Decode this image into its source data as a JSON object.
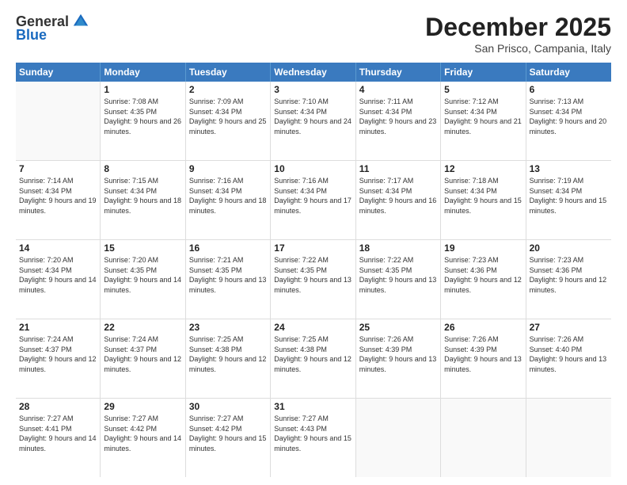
{
  "header": {
    "logo_general": "General",
    "logo_blue": "Blue",
    "month_title": "December 2025",
    "location": "San Prisco, Campania, Italy"
  },
  "days_of_week": [
    "Sunday",
    "Monday",
    "Tuesday",
    "Wednesday",
    "Thursday",
    "Friday",
    "Saturday"
  ],
  "weeks": [
    [
      {
        "day": "",
        "sunrise": "",
        "sunset": "",
        "daylight": ""
      },
      {
        "day": "1",
        "sunrise": "Sunrise: 7:08 AM",
        "sunset": "Sunset: 4:35 PM",
        "daylight": "Daylight: 9 hours and 26 minutes."
      },
      {
        "day": "2",
        "sunrise": "Sunrise: 7:09 AM",
        "sunset": "Sunset: 4:34 PM",
        "daylight": "Daylight: 9 hours and 25 minutes."
      },
      {
        "day": "3",
        "sunrise": "Sunrise: 7:10 AM",
        "sunset": "Sunset: 4:34 PM",
        "daylight": "Daylight: 9 hours and 24 minutes."
      },
      {
        "day": "4",
        "sunrise": "Sunrise: 7:11 AM",
        "sunset": "Sunset: 4:34 PM",
        "daylight": "Daylight: 9 hours and 23 minutes."
      },
      {
        "day": "5",
        "sunrise": "Sunrise: 7:12 AM",
        "sunset": "Sunset: 4:34 PM",
        "daylight": "Daylight: 9 hours and 21 minutes."
      },
      {
        "day": "6",
        "sunrise": "Sunrise: 7:13 AM",
        "sunset": "Sunset: 4:34 PM",
        "daylight": "Daylight: 9 hours and 20 minutes."
      }
    ],
    [
      {
        "day": "7",
        "sunrise": "Sunrise: 7:14 AM",
        "sunset": "Sunset: 4:34 PM",
        "daylight": "Daylight: 9 hours and 19 minutes."
      },
      {
        "day": "8",
        "sunrise": "Sunrise: 7:15 AM",
        "sunset": "Sunset: 4:34 PM",
        "daylight": "Daylight: 9 hours and 18 minutes."
      },
      {
        "day": "9",
        "sunrise": "Sunrise: 7:16 AM",
        "sunset": "Sunset: 4:34 PM",
        "daylight": "Daylight: 9 hours and 18 minutes."
      },
      {
        "day": "10",
        "sunrise": "Sunrise: 7:16 AM",
        "sunset": "Sunset: 4:34 PM",
        "daylight": "Daylight: 9 hours and 17 minutes."
      },
      {
        "day": "11",
        "sunrise": "Sunrise: 7:17 AM",
        "sunset": "Sunset: 4:34 PM",
        "daylight": "Daylight: 9 hours and 16 minutes."
      },
      {
        "day": "12",
        "sunrise": "Sunrise: 7:18 AM",
        "sunset": "Sunset: 4:34 PM",
        "daylight": "Daylight: 9 hours and 15 minutes."
      },
      {
        "day": "13",
        "sunrise": "Sunrise: 7:19 AM",
        "sunset": "Sunset: 4:34 PM",
        "daylight": "Daylight: 9 hours and 15 minutes."
      }
    ],
    [
      {
        "day": "14",
        "sunrise": "Sunrise: 7:20 AM",
        "sunset": "Sunset: 4:34 PM",
        "daylight": "Daylight: 9 hours and 14 minutes."
      },
      {
        "day": "15",
        "sunrise": "Sunrise: 7:20 AM",
        "sunset": "Sunset: 4:35 PM",
        "daylight": "Daylight: 9 hours and 14 minutes."
      },
      {
        "day": "16",
        "sunrise": "Sunrise: 7:21 AM",
        "sunset": "Sunset: 4:35 PM",
        "daylight": "Daylight: 9 hours and 13 minutes."
      },
      {
        "day": "17",
        "sunrise": "Sunrise: 7:22 AM",
        "sunset": "Sunset: 4:35 PM",
        "daylight": "Daylight: 9 hours and 13 minutes."
      },
      {
        "day": "18",
        "sunrise": "Sunrise: 7:22 AM",
        "sunset": "Sunset: 4:35 PM",
        "daylight": "Daylight: 9 hours and 13 minutes."
      },
      {
        "day": "19",
        "sunrise": "Sunrise: 7:23 AM",
        "sunset": "Sunset: 4:36 PM",
        "daylight": "Daylight: 9 hours and 12 minutes."
      },
      {
        "day": "20",
        "sunrise": "Sunrise: 7:23 AM",
        "sunset": "Sunset: 4:36 PM",
        "daylight": "Daylight: 9 hours and 12 minutes."
      }
    ],
    [
      {
        "day": "21",
        "sunrise": "Sunrise: 7:24 AM",
        "sunset": "Sunset: 4:37 PM",
        "daylight": "Daylight: 9 hours and 12 minutes."
      },
      {
        "day": "22",
        "sunrise": "Sunrise: 7:24 AM",
        "sunset": "Sunset: 4:37 PM",
        "daylight": "Daylight: 9 hours and 12 minutes."
      },
      {
        "day": "23",
        "sunrise": "Sunrise: 7:25 AM",
        "sunset": "Sunset: 4:38 PM",
        "daylight": "Daylight: 9 hours and 12 minutes."
      },
      {
        "day": "24",
        "sunrise": "Sunrise: 7:25 AM",
        "sunset": "Sunset: 4:38 PM",
        "daylight": "Daylight: 9 hours and 12 minutes."
      },
      {
        "day": "25",
        "sunrise": "Sunrise: 7:26 AM",
        "sunset": "Sunset: 4:39 PM",
        "daylight": "Daylight: 9 hours and 13 minutes."
      },
      {
        "day": "26",
        "sunrise": "Sunrise: 7:26 AM",
        "sunset": "Sunset: 4:39 PM",
        "daylight": "Daylight: 9 hours and 13 minutes."
      },
      {
        "day": "27",
        "sunrise": "Sunrise: 7:26 AM",
        "sunset": "Sunset: 4:40 PM",
        "daylight": "Daylight: 9 hours and 13 minutes."
      }
    ],
    [
      {
        "day": "28",
        "sunrise": "Sunrise: 7:27 AM",
        "sunset": "Sunset: 4:41 PM",
        "daylight": "Daylight: 9 hours and 14 minutes."
      },
      {
        "day": "29",
        "sunrise": "Sunrise: 7:27 AM",
        "sunset": "Sunset: 4:42 PM",
        "daylight": "Daylight: 9 hours and 14 minutes."
      },
      {
        "day": "30",
        "sunrise": "Sunrise: 7:27 AM",
        "sunset": "Sunset: 4:42 PM",
        "daylight": "Daylight: 9 hours and 15 minutes."
      },
      {
        "day": "31",
        "sunrise": "Sunrise: 7:27 AM",
        "sunset": "Sunset: 4:43 PM",
        "daylight": "Daylight: 9 hours and 15 minutes."
      },
      {
        "day": "",
        "sunrise": "",
        "sunset": "",
        "daylight": ""
      },
      {
        "day": "",
        "sunrise": "",
        "sunset": "",
        "daylight": ""
      },
      {
        "day": "",
        "sunrise": "",
        "sunset": "",
        "daylight": ""
      }
    ]
  ]
}
